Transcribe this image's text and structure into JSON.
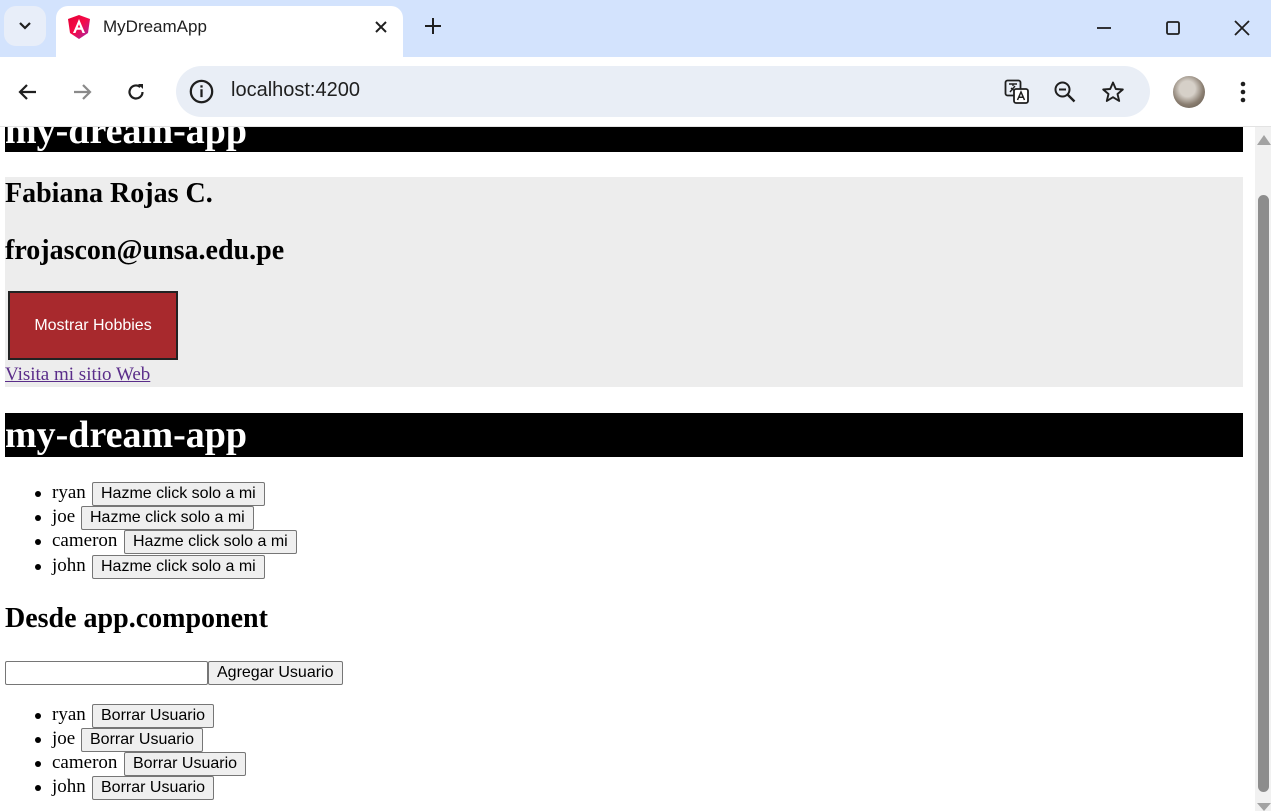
{
  "browser": {
    "tab_title": "MyDreamApp",
    "url": "localhost:4200"
  },
  "page": {
    "top_banner": "my-dream-app",
    "profile": {
      "name": "Fabiana Rojas C.",
      "email": "frojascon@unsa.edu.pe",
      "hobbies_button": "Mostrar Hobbies",
      "website_link": "Visita mi sitio Web"
    },
    "second_banner": "my-dream-app",
    "users_list": [
      {
        "name": "ryan",
        "button": "Hazme click solo a mi"
      },
      {
        "name": "joe",
        "button": "Hazme click solo a mi"
      },
      {
        "name": "cameron",
        "button": "Hazme click solo a mi"
      },
      {
        "name": "john",
        "button": "Hazme click solo a mi"
      }
    ],
    "section_title": "Desde app.component",
    "add_user": {
      "input_value": "",
      "button": "Agregar Usuario"
    },
    "delete_list": [
      {
        "name": "ryan",
        "button": "Borrar Usuario"
      },
      {
        "name": "joe",
        "button": "Borrar Usuario"
      },
      {
        "name": "cameron",
        "button": "Borrar Usuario"
      },
      {
        "name": "john",
        "button": "Borrar Usuario"
      }
    ]
  }
}
